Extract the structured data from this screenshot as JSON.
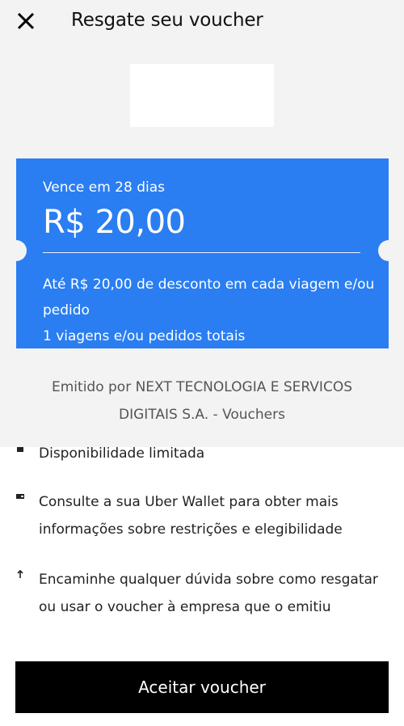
{
  "header": {
    "title": "Resgate seu voucher",
    "close_icon": "close-icon"
  },
  "voucher": {
    "expiry": "Vence em 28 dias",
    "amount": "R$ 20,00",
    "description_line1": "Até R$ 20,00 de desconto em cada viagem e/ou pedido",
    "description_line2": "1 viagens e/ou pedidos totais",
    "card_color": "#2a7ef2"
  },
  "issuer": {
    "text_line1": "Emitido por NEXT TECNOLOGIA E SERVICOS",
    "text_line2": "DIGITAIS S.A. - Vouchers"
  },
  "info_items": [
    {
      "icon": "lock-icon",
      "text": "Disponibilidade limitada"
    },
    {
      "icon": "wallet-icon",
      "text": "Consulte a sua Uber Wallet para obter mais informações sobre restrições e elegibilidade"
    },
    {
      "icon": "arrow-up-icon",
      "text": "Encaminhe qualquer dúvida sobre como resgatar ou usar o voucher à empresa que o emitiu"
    }
  ],
  "actions": {
    "accept_label": "Aceitar voucher"
  }
}
